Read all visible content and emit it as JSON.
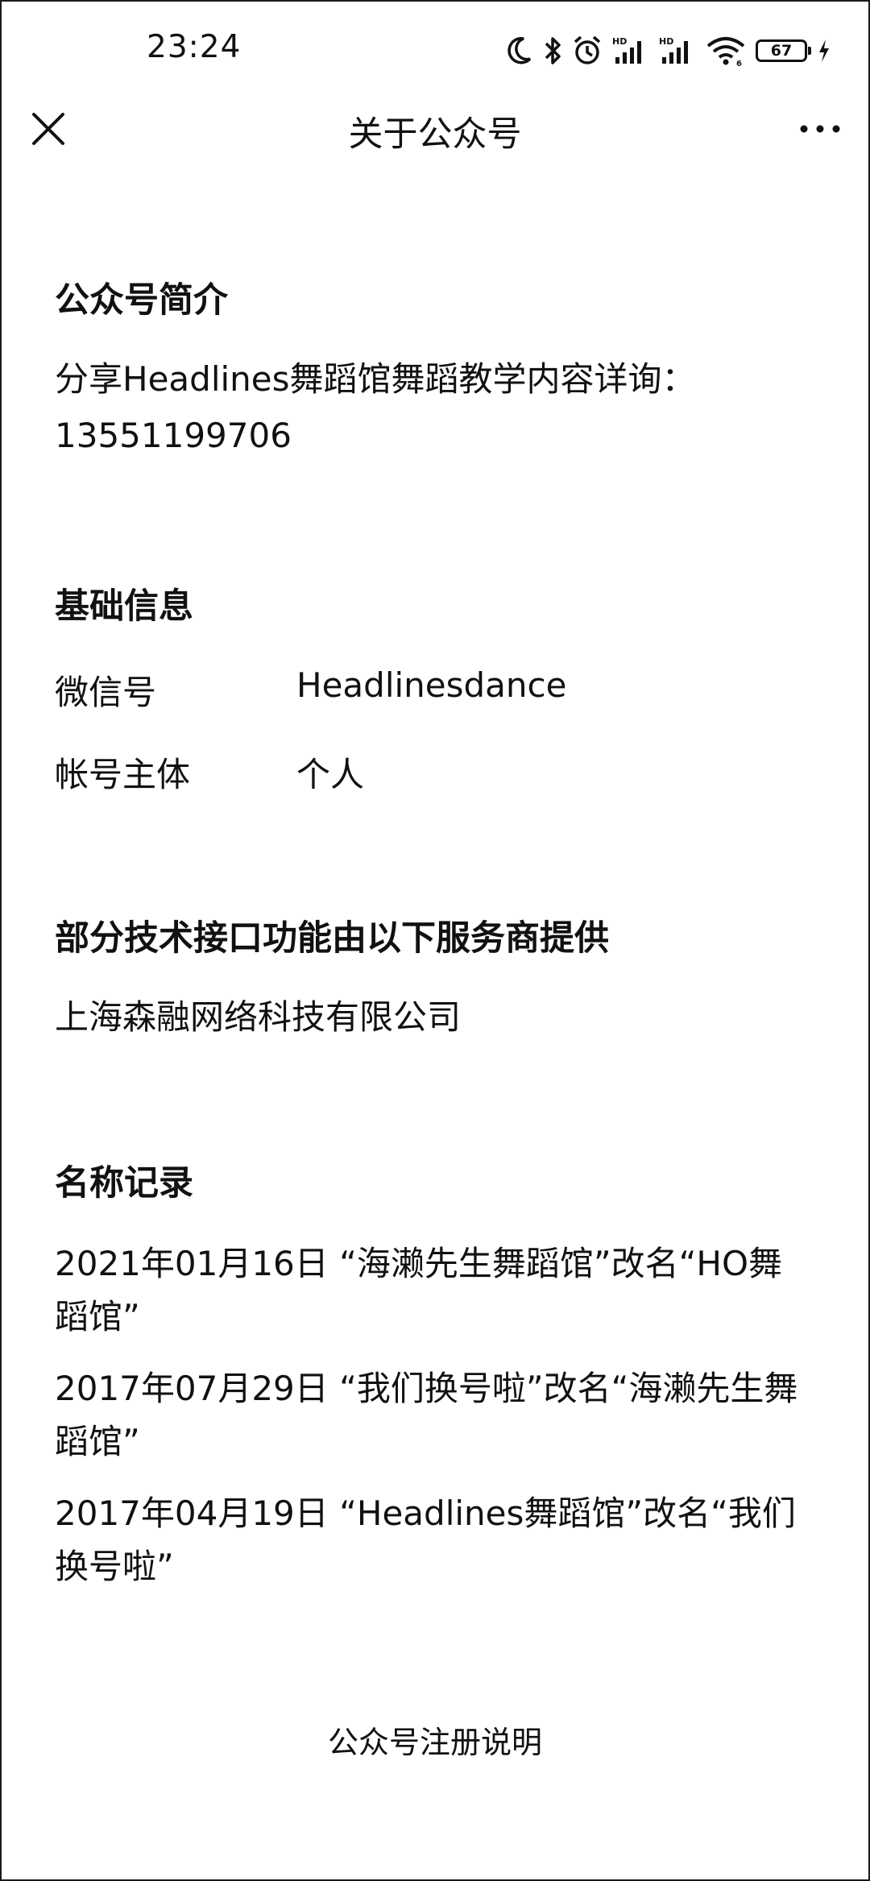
{
  "status_bar": {
    "time": "23:24",
    "battery_level": "67",
    "icons": [
      "moon-icon",
      "bluetooth-icon",
      "alarm-icon",
      "hd-signal-icon",
      "hd-signal-icon",
      "wifi-icon",
      "battery-icon",
      "charging-icon"
    ]
  },
  "nav": {
    "title": "关于公众号",
    "close_icon": "close-icon",
    "more_icon": "more-icon"
  },
  "intro": {
    "heading": "公众号简介",
    "text": "分享Headlines舞蹈馆舞蹈教学内容详询：13551199706"
  },
  "basic_info": {
    "heading": "基础信息",
    "rows": [
      {
        "label": "微信号",
        "value": "Headlinesdance"
      },
      {
        "label": "帐号主体",
        "value": "个人"
      }
    ]
  },
  "service": {
    "heading": "部分技术接口功能由以下服务商提供",
    "provider": "上海森融网络科技有限公司"
  },
  "name_history": {
    "heading": "名称记录",
    "records": [
      "2021年01月16日 “海濑先生舞蹈馆”改名“HO舞蹈馆”",
      "2017年07月29日 “我们换号啦”改名“海濑先生舞蹈馆”",
      "2017年04月19日 “Headlines舞蹈馆”改名“我们换号啦”"
    ]
  },
  "footer": {
    "link": "公众号注册说明"
  }
}
